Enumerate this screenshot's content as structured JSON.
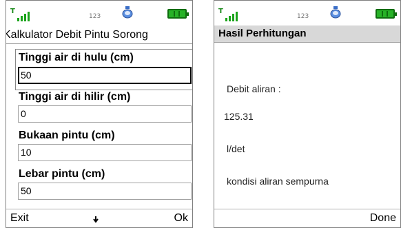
{
  "status": {
    "center_text": "123"
  },
  "left": {
    "title": "Kalkulator Debit Pintu Sorong",
    "fields": [
      {
        "label": "Tinggi air di hulu (cm)",
        "value": "50"
      },
      {
        "label": "Tinggi air di hilir (cm)",
        "value": "0"
      },
      {
        "label": "Bukaan pintu (cm)",
        "value": "10"
      },
      {
        "label": "Lebar pintu (cm)",
        "value": "50"
      }
    ],
    "soft_left": "Exit",
    "soft_right": "Ok"
  },
  "right": {
    "title": "Hasil Perhitungan",
    "lines": [
      "Debit aliran :",
      "125.31",
      "l/det",
      "kondisi aliran sempurna"
    ],
    "soft_right": "Done"
  },
  "colors": {
    "battery": "#27b227",
    "signal": "#1aa31a",
    "title_bar_bg": "#d8d8d8"
  }
}
